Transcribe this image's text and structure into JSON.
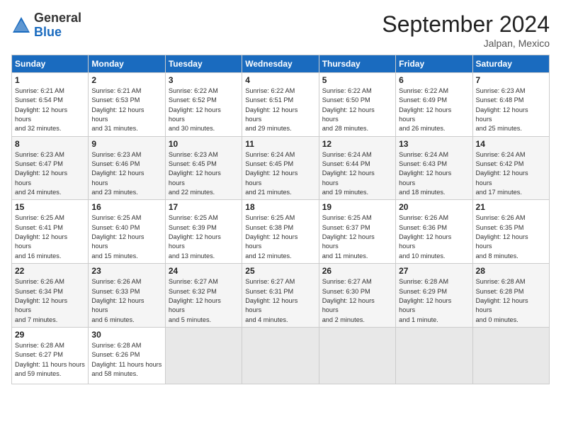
{
  "header": {
    "logo_general": "General",
    "logo_blue": "Blue",
    "month_title": "September 2024",
    "subtitle": "Jalpan, Mexico"
  },
  "days_of_week": [
    "Sunday",
    "Monday",
    "Tuesday",
    "Wednesday",
    "Thursday",
    "Friday",
    "Saturday"
  ],
  "weeks": [
    [
      {
        "day": "1",
        "sunrise": "6:21 AM",
        "sunset": "6:54 PM",
        "daylight": "12 hours and 32 minutes."
      },
      {
        "day": "2",
        "sunrise": "6:21 AM",
        "sunset": "6:53 PM",
        "daylight": "12 hours and 31 minutes."
      },
      {
        "day": "3",
        "sunrise": "6:22 AM",
        "sunset": "6:52 PM",
        "daylight": "12 hours and 30 minutes."
      },
      {
        "day": "4",
        "sunrise": "6:22 AM",
        "sunset": "6:51 PM",
        "daylight": "12 hours and 29 minutes."
      },
      {
        "day": "5",
        "sunrise": "6:22 AM",
        "sunset": "6:50 PM",
        "daylight": "12 hours and 28 minutes."
      },
      {
        "day": "6",
        "sunrise": "6:22 AM",
        "sunset": "6:49 PM",
        "daylight": "12 hours and 26 minutes."
      },
      {
        "day": "7",
        "sunrise": "6:23 AM",
        "sunset": "6:48 PM",
        "daylight": "12 hours and 25 minutes."
      }
    ],
    [
      {
        "day": "8",
        "sunrise": "6:23 AM",
        "sunset": "6:47 PM",
        "daylight": "12 hours and 24 minutes."
      },
      {
        "day": "9",
        "sunrise": "6:23 AM",
        "sunset": "6:46 PM",
        "daylight": "12 hours and 23 minutes."
      },
      {
        "day": "10",
        "sunrise": "6:23 AM",
        "sunset": "6:45 PM",
        "daylight": "12 hours and 22 minutes."
      },
      {
        "day": "11",
        "sunrise": "6:24 AM",
        "sunset": "6:45 PM",
        "daylight": "12 hours and 21 minutes."
      },
      {
        "day": "12",
        "sunrise": "6:24 AM",
        "sunset": "6:44 PM",
        "daylight": "12 hours and 19 minutes."
      },
      {
        "day": "13",
        "sunrise": "6:24 AM",
        "sunset": "6:43 PM",
        "daylight": "12 hours and 18 minutes."
      },
      {
        "day": "14",
        "sunrise": "6:24 AM",
        "sunset": "6:42 PM",
        "daylight": "12 hours and 17 minutes."
      }
    ],
    [
      {
        "day": "15",
        "sunrise": "6:25 AM",
        "sunset": "6:41 PM",
        "daylight": "12 hours and 16 minutes."
      },
      {
        "day": "16",
        "sunrise": "6:25 AM",
        "sunset": "6:40 PM",
        "daylight": "12 hours and 15 minutes."
      },
      {
        "day": "17",
        "sunrise": "6:25 AM",
        "sunset": "6:39 PM",
        "daylight": "12 hours and 13 minutes."
      },
      {
        "day": "18",
        "sunrise": "6:25 AM",
        "sunset": "6:38 PM",
        "daylight": "12 hours and 12 minutes."
      },
      {
        "day": "19",
        "sunrise": "6:25 AM",
        "sunset": "6:37 PM",
        "daylight": "12 hours and 11 minutes."
      },
      {
        "day": "20",
        "sunrise": "6:26 AM",
        "sunset": "6:36 PM",
        "daylight": "12 hours and 10 minutes."
      },
      {
        "day": "21",
        "sunrise": "6:26 AM",
        "sunset": "6:35 PM",
        "daylight": "12 hours and 8 minutes."
      }
    ],
    [
      {
        "day": "22",
        "sunrise": "6:26 AM",
        "sunset": "6:34 PM",
        "daylight": "12 hours and 7 minutes."
      },
      {
        "day": "23",
        "sunrise": "6:26 AM",
        "sunset": "6:33 PM",
        "daylight": "12 hours and 6 minutes."
      },
      {
        "day": "24",
        "sunrise": "6:27 AM",
        "sunset": "6:32 PM",
        "daylight": "12 hours and 5 minutes."
      },
      {
        "day": "25",
        "sunrise": "6:27 AM",
        "sunset": "6:31 PM",
        "daylight": "12 hours and 4 minutes."
      },
      {
        "day": "26",
        "sunrise": "6:27 AM",
        "sunset": "6:30 PM",
        "daylight": "12 hours and 2 minutes."
      },
      {
        "day": "27",
        "sunrise": "6:28 AM",
        "sunset": "6:29 PM",
        "daylight": "12 hours and 1 minute."
      },
      {
        "day": "28",
        "sunrise": "6:28 AM",
        "sunset": "6:28 PM",
        "daylight": "12 hours and 0 minutes."
      }
    ],
    [
      {
        "day": "29",
        "sunrise": "6:28 AM",
        "sunset": "6:27 PM",
        "daylight": "11 hours and 59 minutes."
      },
      {
        "day": "30",
        "sunrise": "6:28 AM",
        "sunset": "6:26 PM",
        "daylight": "11 hours and 58 minutes."
      },
      null,
      null,
      null,
      null,
      null
    ]
  ]
}
